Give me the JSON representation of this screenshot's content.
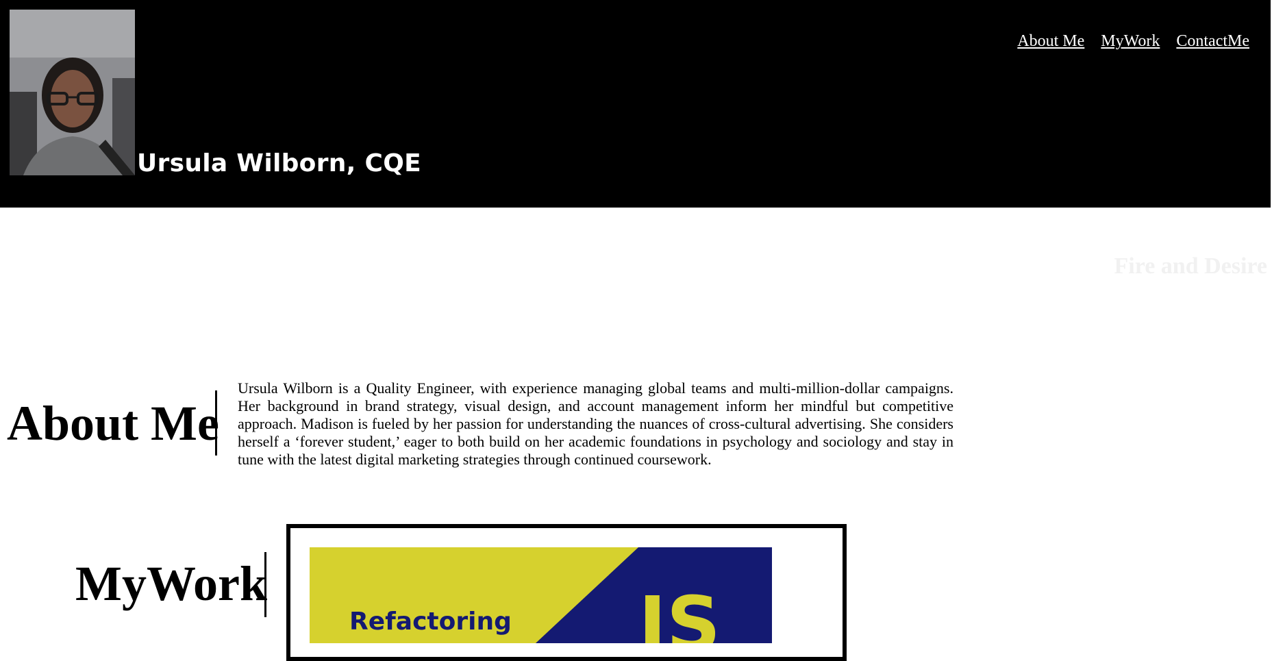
{
  "header": {
    "name": "Ursula Wilborn, CQE",
    "photo_alt": "Profile photo",
    "nav": [
      {
        "label": "About Me"
      },
      {
        "label": "MyWork"
      },
      {
        "label": "ContactMe"
      }
    ]
  },
  "hero": {
    "tagline": "Fire and Desire"
  },
  "about": {
    "heading": "About Me",
    "text": "Ursula Wilborn is a Quality Engineer, with experience managing global teams and multi-million-dollar campaigns. Her background in brand strategy, visual design, and account management inform her mindful but competitive approach. Madison is fueled by her passion for understanding the nuances of cross-cultural advertising. She considers herself a ‘forever student,’ eager to both build on her academic foundations in psychology and sociology and stay in tune with the latest digital marketing strategies through continued coursework."
  },
  "work": {
    "heading": "MyWork",
    "projects": [
      {
        "title": "Refactoring",
        "badge": "JS"
      }
    ]
  },
  "colors": {
    "header_bg": "#000000",
    "thumb_yellow": "#d6d12e",
    "thumb_navy": "#141a72"
  }
}
